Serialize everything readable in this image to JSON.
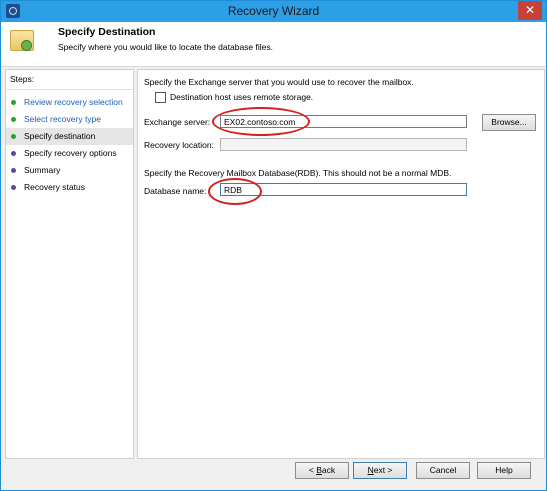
{
  "window": {
    "title": "Recovery Wizard",
    "close_label": "✕"
  },
  "header": {
    "title": "Specify Destination",
    "subtitle": "Specify where you would like to locate the database files."
  },
  "steps": {
    "heading": "Steps:",
    "items": [
      {
        "label": "Review recovery selection",
        "state": "done"
      },
      {
        "label": "Select recovery type",
        "state": "done"
      },
      {
        "label": "Specify destination",
        "state": "current"
      },
      {
        "label": "Specify recovery options",
        "state": "pending"
      },
      {
        "label": "Summary",
        "state": "pending"
      },
      {
        "label": "Recovery status",
        "state": "pending"
      }
    ]
  },
  "form": {
    "intro": "Specify the Exchange server that you would use to recover the mailbox.",
    "remote_storage_label": "Destination host uses remote storage.",
    "remote_storage_checked": false,
    "exchange_server_label": "Exchange server:",
    "exchange_server_value": "EX02.contoso.com",
    "browse_label": "Browse...",
    "recovery_location_label": "Recovery location:",
    "recovery_location_value": "",
    "rdb_intro": "Specify the Recovery Mailbox Database(RDB). This should not be a normal MDB.",
    "database_name_label": "Database name:",
    "database_name_value": "RDB"
  },
  "footer": {
    "back_prefix": "< ",
    "back_key": "B",
    "back_rest": "ack",
    "next_key": "N",
    "next_rest": "ext >",
    "cancel_label": "Cancel",
    "help_label": "Help"
  },
  "colors": {
    "annotation": "#d7201e",
    "titlebar": "#2d9fe6",
    "done_dot": "#2ca02c",
    "pending_dot": "#6b3fa0"
  }
}
